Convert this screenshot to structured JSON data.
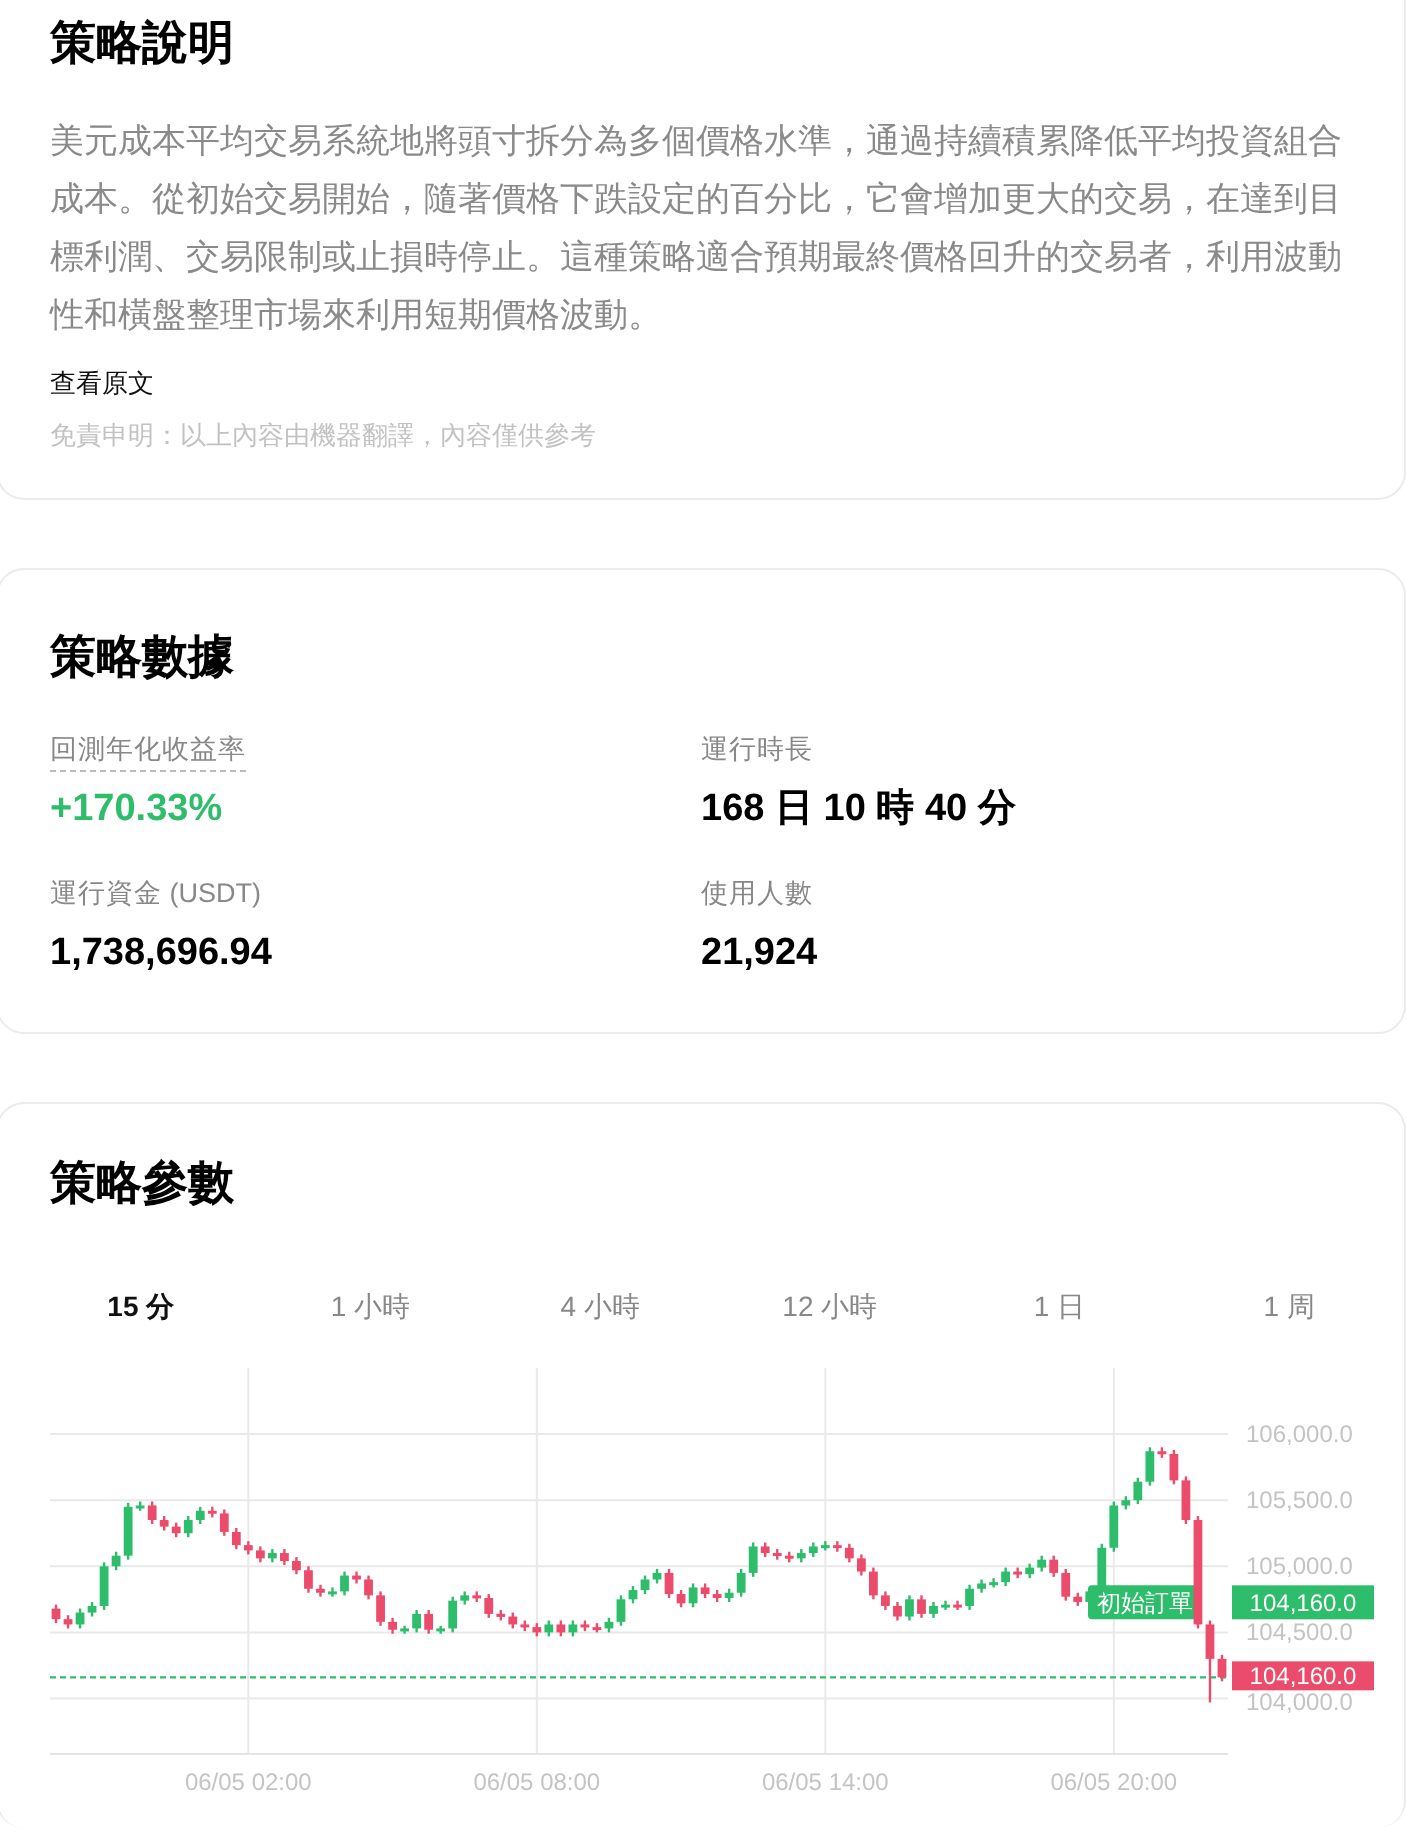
{
  "description": {
    "title": "策略說明",
    "body": "美元成本平均交易系統地將頭寸拆分為多個價格水準，通過持續積累降低平均投資組合成本。從初始交易開始，隨著價格下跌設定的百分比，它會增加更大的交易，在達到目標利潤、交易限制或止損時停止。這種策略適合預期最終價格回升的交易者，利用波動性和橫盤整理市場來利用短期價格波動。",
    "link": "查看原文",
    "disclaimer": "免責申明：以上內容由機器翻譯，內容僅供參考"
  },
  "stats": {
    "title": "策略數據",
    "metrics": [
      {
        "label": "回測年化收益率",
        "value": "+170.33%",
        "has_tooltip": true,
        "color": "#2ebd6b"
      },
      {
        "label": "運行時長",
        "value": "168 日 10 時 40 分",
        "has_tooltip": false,
        "color": "#000000"
      },
      {
        "label": "運行資金 (USDT)",
        "value": "1,738,696.94",
        "has_tooltip": false,
        "color": "#000000"
      },
      {
        "label": "使用人數",
        "value": "21,924",
        "has_tooltip": false,
        "color": "#000000"
      }
    ]
  },
  "params": {
    "title": "策略參數",
    "tabs": [
      {
        "label": "15 分",
        "selected": true
      },
      {
        "label": "1 小時",
        "selected": false
      },
      {
        "label": "4 小時",
        "selected": false
      },
      {
        "label": "12 小時",
        "selected": false
      },
      {
        "label": "1 日",
        "selected": false
      },
      {
        "label": "1 周",
        "selected": false
      }
    ],
    "chart_data": {
      "type": "candlestick",
      "grid": true,
      "ylim": [
        103580,
        106500
      ],
      "yticks": [
        {
          "value": 104000,
          "label": "104,000.0"
        },
        {
          "value": 104500,
          "label": "104,500.0"
        },
        {
          "value": 105000,
          "label": "105,000.0"
        },
        {
          "value": 105500,
          "label": "105,500.0"
        },
        {
          "value": 106000,
          "label": "106,000.0"
        }
      ],
      "categories": [
        null,
        null,
        null,
        null,
        null,
        null,
        null,
        null,
        null,
        null,
        null,
        null,
        null,
        null,
        null,
        null,
        "06/05 02:00",
        null,
        null,
        null,
        null,
        null,
        null,
        null,
        null,
        null,
        null,
        null,
        null,
        null,
        null,
        null,
        null,
        null,
        null,
        null,
        null,
        null,
        null,
        null,
        "06/05 08:00",
        null,
        null,
        null,
        null,
        null,
        null,
        null,
        null,
        null,
        null,
        null,
        null,
        null,
        null,
        null,
        null,
        null,
        null,
        null,
        null,
        null,
        null,
        null,
        "06/05 14:00",
        null,
        null,
        null,
        null,
        null,
        null,
        null,
        null,
        null,
        null,
        null,
        null,
        null,
        null,
        null,
        null,
        null,
        null,
        null,
        null,
        null,
        null,
        null,
        "06/05 20:00",
        null,
        null,
        null,
        null,
        null,
        null,
        null,
        null,
        null
      ],
      "ohlc": [
        [
          104680,
          104710,
          104570,
          104600
        ],
        [
          104600,
          104630,
          104530,
          104560
        ],
        [
          104560,
          104680,
          104530,
          104650
        ],
        [
          104650,
          104730,
          104620,
          104700
        ],
        [
          104700,
          105030,
          104670,
          105000
        ],
        [
          105000,
          105110,
          104970,
          105080
        ],
        [
          105080,
          105480,
          105050,
          105450
        ],
        [
          105450,
          105490,
          105420,
          105460
        ],
        [
          105460,
          105490,
          105320,
          105350
        ],
        [
          105350,
          105380,
          105270,
          105300
        ],
        [
          105300,
          105330,
          105220,
          105250
        ],
        [
          105250,
          105380,
          105220,
          105350
        ],
        [
          105350,
          105450,
          105320,
          105420
        ],
        [
          105420,
          105450,
          105370,
          105400
        ],
        [
          105400,
          105430,
          105230,
          105260
        ],
        [
          105260,
          105290,
          105130,
          105160
        ],
        [
          105160,
          105190,
          105090,
          105120
        ],
        [
          105120,
          105150,
          105030,
          105060
        ],
        [
          105060,
          105130,
          105030,
          105100
        ],
        [
          105100,
          105130,
          105010,
          105040
        ],
        [
          105040,
          105070,
          104940,
          104970
        ],
        [
          104970,
          105000,
          104800,
          104830
        ],
        [
          104830,
          104860,
          104770,
          104800
        ],
        [
          104800,
          104840,
          104770,
          104810
        ],
        [
          104810,
          104960,
          104780,
          104930
        ],
        [
          104930,
          104960,
          104870,
          104900
        ],
        [
          104900,
          104930,
          104750,
          104780
        ],
        [
          104780,
          104810,
          104550,
          104580
        ],
        [
          104580,
          104610,
          104490,
          104520
        ],
        [
          104520,
          104550,
          104490,
          104530
        ],
        [
          104530,
          104670,
          104500,
          104640
        ],
        [
          104640,
          104670,
          104490,
          104520
        ],
        [
          104520,
          104550,
          104490,
          104530
        ],
        [
          104530,
          104770,
          104500,
          104740
        ],
        [
          104740,
          104810,
          104710,
          104780
        ],
        [
          104780,
          104810,
          104730,
          104760
        ],
        [
          104760,
          104790,
          104610,
          104640
        ],
        [
          104640,
          104670,
          104590,
          104620
        ],
        [
          104620,
          104650,
          104530,
          104560
        ],
        [
          104560,
          104590,
          104510,
          104540
        ],
        [
          104540,
          104570,
          104470,
          104500
        ],
        [
          104500,
          104590,
          104470,
          104560
        ],
        [
          104560,
          104590,
          104470,
          104500
        ],
        [
          104500,
          104590,
          104470,
          104560
        ],
        [
          104560,
          104590,
          104510,
          104540
        ],
        [
          104540,
          104570,
          104500,
          104530
        ],
        [
          104530,
          104610,
          104500,
          104580
        ],
        [
          104580,
          104780,
          104550,
          104750
        ],
        [
          104750,
          104850,
          104720,
          104820
        ],
        [
          104820,
          104930,
          104790,
          104900
        ],
        [
          104900,
          104980,
          104870,
          104950
        ],
        [
          104950,
          104980,
          104760,
          104790
        ],
        [
          104790,
          104820,
          104690,
          104720
        ],
        [
          104720,
          104870,
          104690,
          104840
        ],
        [
          104840,
          104870,
          104760,
          104790
        ],
        [
          104790,
          104820,
          104730,
          104760
        ],
        [
          104760,
          104830,
          104730,
          104800
        ],
        [
          104800,
          104980,
          104770,
          104950
        ],
        [
          104950,
          105180,
          104920,
          105150
        ],
        [
          105150,
          105180,
          105070,
          105100
        ],
        [
          105100,
          105130,
          105050,
          105080
        ],
        [
          105080,
          105110,
          105030,
          105060
        ],
        [
          105060,
          105130,
          105030,
          105100
        ],
        [
          105100,
          105180,
          105070,
          105150
        ],
        [
          105150,
          105190,
          105120,
          105160
        ],
        [
          105160,
          105190,
          105110,
          105140
        ],
        [
          105140,
          105170,
          105030,
          105060
        ],
        [
          105060,
          105090,
          104930,
          104960
        ],
        [
          104960,
          104990,
          104750,
          104780
        ],
        [
          104780,
          104810,
          104670,
          104700
        ],
        [
          104700,
          104730,
          104590,
          104620
        ],
        [
          104620,
          104780,
          104590,
          104750
        ],
        [
          104750,
          104780,
          104610,
          104640
        ],
        [
          104640,
          104730,
          104610,
          104700
        ],
        [
          104700,
          104740,
          104670,
          104710
        ],
        [
          104710,
          104740,
          104670,
          104700
        ],
        [
          104700,
          104860,
          104670,
          104830
        ],
        [
          104830,
          104900,
          104800,
          104870
        ],
        [
          104870,
          104910,
          104840,
          104880
        ],
        [
          104880,
          104990,
          104850,
          104960
        ],
        [
          104960,
          104990,
          104910,
          104940
        ],
        [
          104940,
          105020,
          104910,
          104990
        ],
        [
          104990,
          105080,
          104960,
          105050
        ],
        [
          105050,
          105080,
          104920,
          104950
        ],
        [
          104950,
          104980,
          104740,
          104770
        ],
        [
          104770,
          104800,
          104700,
          104730
        ],
        [
          104730,
          104840,
          104700,
          104810
        ],
        [
          104810,
          105170,
          104780,
          105140
        ],
        [
          105140,
          105490,
          105110,
          105460
        ],
        [
          105460,
          105530,
          105430,
          105500
        ],
        [
          105500,
          105670,
          105470,
          105640
        ],
        [
          105640,
          105900,
          105610,
          105870
        ],
        [
          105870,
          105900,
          105820,
          105850
        ],
        [
          105850,
          105880,
          105620,
          105650
        ],
        [
          105650,
          105680,
          105320,
          105350
        ],
        [
          105350,
          105380,
          104530,
          104560
        ],
        [
          104560,
          104590,
          103970,
          104300
        ],
        [
          104300,
          104330,
          104130,
          104160
        ]
      ],
      "ref_lines": [
        {
          "axis": "y",
          "value": 104160,
          "label": "104,160.0",
          "color": "#2ebd6b",
          "line_style": "dashed"
        }
      ],
      "annotations": [
        "初始訂單",
        "104,160.0"
      ]
    }
  }
}
